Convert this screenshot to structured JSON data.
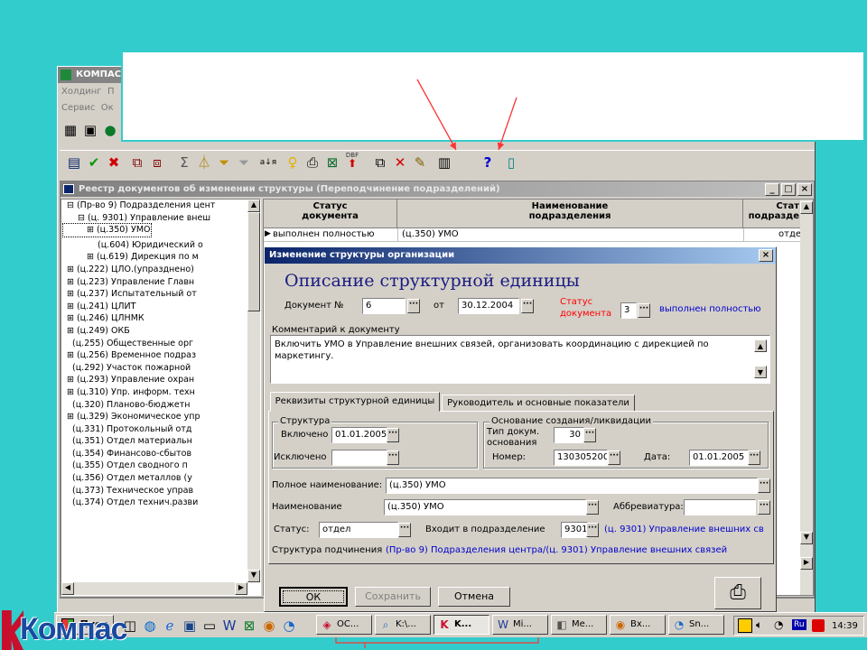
{
  "app": {
    "title": "КОМПАС",
    "menu_row1": [
      "Холдинг",
      "П"
    ],
    "menu_row2": [
      "Сервис",
      "Ок"
    ]
  },
  "callout": {
    "text": ""
  },
  "toolbar": {
    "icons": [
      "table-icon",
      "check-icon",
      "cross-icon",
      "add-record-icon",
      "copy-record-icon",
      "sum-icon",
      "filter-icon",
      "filter-set-icon",
      "filter-clear-icon",
      "sort-icon",
      "idea-icon",
      "print-icon",
      "excel-icon",
      "dbf-export-icon",
      "copy-icon",
      "delete-icon",
      "edit-icon",
      "structure-icon",
      "help-icon",
      "exit-icon"
    ],
    "sort_glyph": "а↓я",
    "dbf_label": "DBF"
  },
  "registry": {
    "title": "Реестр документов об изменении структуры (Переподчинение подразделений)",
    "tree": [
      "⊟ (Пр-во 9) Подразделения цент",
      "⊟ (ц. 9301) Управление внеш",
      "⊞ (ц.350) УМО",
      "(ц.604) Юридический о",
      "⊞ (ц.619) Дирекция по м",
      "⊞ (ц.222) ЦЛО.(упразднено)",
      "⊞ (ц.223) Управление Главн",
      "⊞ (ц.237) Испытательный от",
      "⊞ (ц.241) ЦЛИТ",
      "⊞ (ц.246) ЦЛНМК",
      "⊞ (ц.249) ОКБ",
      "(ц.255) Общественные орг",
      "⊞ (ц.256) Временное подраз",
      "(ц.292) Участок пожарной",
      "⊞ (ц.293) Управление охран",
      "⊞ (ц.310) Упр. информ. техн",
      "(ц.320) Планово-бюджетн",
      "⊞ (ц.329) Экономическое упр",
      "(ц.331) Протокольный отд",
      "(ц.351) Отдел материальн",
      "(ц.354) Финансово-сбытов",
      "(ц.355) Отдел сводного п",
      "(ц.356) Отдел металлов (у",
      "(ц.373) Техническое управ",
      "(ц.374) Отдел технич.разви"
    ],
    "columns": [
      "Статус документа",
      "Наименование подразделения",
      "Стат подразде"
    ],
    "rows": [
      [
        "выполнен полностью",
        "(ц.350) УМО",
        "отде"
      ]
    ]
  },
  "dialog": {
    "title": "Изменение структуры организации",
    "heading": "Описание структурной единицы",
    "doc_no_label": "Документ №",
    "doc_no": "6",
    "from_label": "от",
    "doc_date": "30.12.2004",
    "status_label_1": "Статус",
    "status_label_2": "документа",
    "status_code": "3",
    "status_text": "выполнен полностью",
    "comment_label": "Комментарий к документу",
    "comment": "Включить УМО в Управление внешних связей, организовать координацию с дирекцией по маркетингу.",
    "tabs": [
      "Реквизиты структурной единицы",
      "Руководитель и основные показатели"
    ],
    "structure_group": "Структура",
    "included_label": "Включено",
    "included": "01.01.2005",
    "excluded_label": "Исключено",
    "excluded": "",
    "basis_group": "Основание создания/ликвидации",
    "doc_type_label_1": "Тип докум.",
    "doc_type_label_2": "основания",
    "doc_type": "30",
    "number_label": "Номер:",
    "number": "130305200",
    "date_label": "Дата:",
    "date": "01.01.2005",
    "full_name_label": "Полное наименование:",
    "full_name": "(ц.350) УМО",
    "name_label": "Наименование",
    "name": "(ц.350) УМО",
    "abbr_label": "Аббревиатура:",
    "abbr": "",
    "status_label": "Статус:",
    "status_value": "отдел",
    "parent_label": "Входит в подразделение",
    "parent_code": "9301",
    "parent_name": "(ц. 9301) Управление внешних св",
    "subordination_label": "Структура подчинения",
    "subordination": "(Пр-во 9) Подразделения центра/(ц. 9301) Управление внешних связей",
    "ok": "ОК",
    "save": "Сохранить",
    "cancel": "Отмена"
  },
  "taskbar": {
    "start": "Пуск",
    "tasks": [
      "ОС...",
      "K:\\...",
      "K...",
      "Mi...",
      "Ме...",
      "Вх...",
      "Sn..."
    ],
    "lang": "Ru",
    "clock": "14:39"
  },
  "logo": {
    "text": "Компас"
  },
  "colors": {
    "desktop": "#33cccc",
    "title_active": "#0a246a",
    "callout_border": "#33cccc",
    "arrow": "#ff3333"
  }
}
